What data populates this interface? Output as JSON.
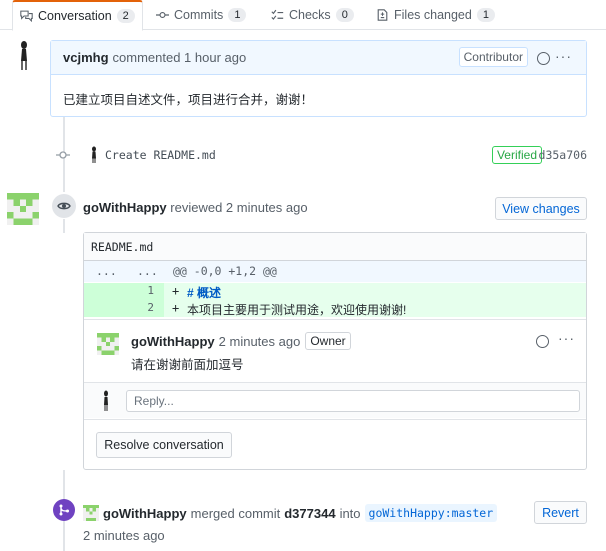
{
  "tabs": [
    {
      "label": "Conversation",
      "count": "2"
    },
    {
      "label": "Commits",
      "count": "1"
    },
    {
      "label": "Checks",
      "count": "0"
    },
    {
      "label": "Files changed",
      "count": "1"
    }
  ],
  "comment": {
    "author": "vcjmhg",
    "action": "commented 1 hour ago",
    "badge": "Contributor",
    "body": "已建立项目自述文件，项目进行合并，谢谢！",
    "menu": "···"
  },
  "commit": {
    "message": "Create README.md",
    "verified": "Verified",
    "sha": "d35a706"
  },
  "review": {
    "author": "goWithHappy",
    "action": "reviewed 2 minutes ago",
    "view_changes": "View changes",
    "file": "README.md",
    "hunk_left": "...",
    "hunk_right": "...",
    "hunk_header": "@@ -0,0 +1,2 @@",
    "lines": [
      {
        "num": "1",
        "prefix": "+ ",
        "text": "# 概述"
      },
      {
        "num": "2",
        "prefix": "+ ",
        "text": "本项目主要用于测试用途，欢迎使用谢谢!"
      }
    ],
    "reply_comment": {
      "author": "goWithHappy",
      "time": "2 minutes ago",
      "badge": "Owner",
      "body": "请在谢谢前面加逗号",
      "menu": "···"
    },
    "reply_placeholder": "Reply...",
    "resolve": "Resolve conversation"
  },
  "merge": {
    "author": "goWithHappy",
    "text1": "merged commit",
    "commit": "d377344",
    "text2": "into",
    "branch": "goWithHappy:master",
    "time": "2 minutes ago",
    "revert": "Revert"
  },
  "colors": {
    "accent": "#0366d6",
    "merge": "#6f42c1",
    "verified": "#28a745",
    "tab_active": "#e36209"
  }
}
